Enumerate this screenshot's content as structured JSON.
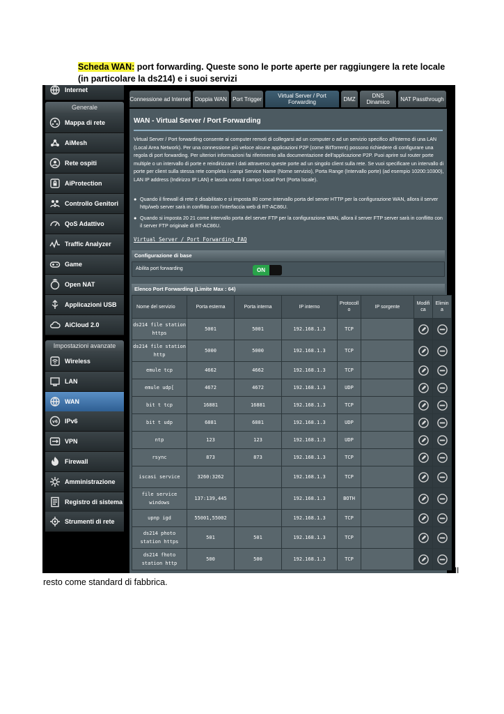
{
  "doc": {
    "header_highlight": "Scheda WAN:",
    "header_text": " port forwarding. Queste sono le porte aperte per raggiungere la rete locale (in particolare la ds214) e i suoi servizi",
    "footer_right": "Il",
    "footer_text": "resto come standard di fabbrica."
  },
  "sidebar": {
    "top_item": "Internet",
    "general_header": "Generale",
    "general_items": [
      "Mappa di rete",
      "AiMesh",
      "Rete ospiti",
      "AiProtection",
      "Controllo Genitori",
      "QoS Adattivo",
      "Traffic Analyzer",
      "Game",
      "Open NAT",
      "Applicazioni USB",
      "AiCloud 2.0"
    ],
    "advanced_header": "Impostazioni avanzate",
    "advanced_items": [
      "Wireless",
      "LAN",
      "WAN",
      "IPv6",
      "VPN",
      "Firewall",
      "Amministrazione",
      "Registro di sistema",
      "Strumenti di rete"
    ],
    "active_item": "WAN",
    "icons": {
      "internet": "globe-icon",
      "network-map": "network-icon",
      "aimesh": "mesh-icon",
      "guest": "guest-network-icon",
      "aiprotection": "shield-lock-icon",
      "parental": "family-icon",
      "qos": "gauge-icon",
      "traffic": "chart-icon",
      "game": "gamepad-icon",
      "opennat": "nat-icon",
      "usb": "usb-icon",
      "aicloud": "cloud-icon",
      "wireless": "wifi-icon",
      "lan": "lan-icon",
      "wan": "wan-globe-icon",
      "ipv6": "ipv6-icon",
      "vpn": "vpn-icon",
      "firewall": "fire-icon",
      "admin": "admin-icon",
      "syslog": "log-icon",
      "tools": "tools-icon"
    }
  },
  "tabs": [
    "Connessione ad Internet",
    "Doppia WAN",
    "Port Trigger",
    "Virtual Server / Port Forwarding",
    "DMZ",
    "DNS Dinamico",
    "NAT Passthrough"
  ],
  "active_tab": "Virtual Server / Port Forwarding",
  "main": {
    "title": "WAN - Virtual Server / Port Forwarding",
    "description": "Virtual Server / Port forwarding consente ai computer remoti di collegarsi ad un computer o ad un servizio specifico all'interno di una LAN (Local Area Network). Per una connessione più veloce alcune applicazioni P2P (come BitTorrent) possono richiedere di configurare una regola di port forwarding. Per ulteriori informazioni fai riferimento alla documentazione dell'applicazione P2P. Puoi aprire sul router porte multiple o un intervallo di porte e reindirizzare i dati attraverso queste porte ad un singolo client sulla rete. Se vuoi specificare un intervallo di porte per client sulla stessa rete completa i campi Service Name (Nome servizio), Porta Range (Intervallo porte) (ad esempio 10200:10300), LAN IP address (Indirizzo IP LAN) e lascia vuoto il campo Local Port (Porta locale).",
    "bullet1": "Quando il firewall di rete è disabilitato e si imposta 80 come intervallo porta del server HTTP per la configurazione WAN, allora il server http/web server sarà in conflitto con l'interfaccia web di RT-AC86U.",
    "bullet2": "Quando si imposta 20 21 come intervallo porta del server FTP per la configurazione WAN, allora il server FTP server sarà in conflitto con il server FTP originale di RT-AC86U.",
    "faq_link": "Virtual Server / Port Forwarding FAQ",
    "basic_config_header": "Configurazione di base",
    "enable_label": "Abilita port forwarding",
    "toggle_label": "ON",
    "toggle_on_color": "#29a34a",
    "list_header": "Elenco Port Forwarding (Limite Max : 64)"
  },
  "table": {
    "columns": [
      "Nome del servizio",
      "Porta esterna",
      "Porta interna",
      "IP interno",
      "Protocoll o",
      "IP sorgente",
      "Modifi ca",
      "Elimin a"
    ],
    "rows": [
      {
        "name": "ds214 file station https",
        "ext": "5001",
        "int": "5001",
        "ip": "192.168.1.3",
        "proto": "TCP",
        "src": ""
      },
      {
        "name": "ds214 file station http",
        "ext": "5000",
        "int": "5000",
        "ip": "192.168.1.3",
        "proto": "TCP",
        "src": ""
      },
      {
        "name": "emule tcp",
        "ext": "4662",
        "int": "4662",
        "ip": "192.168.1.3",
        "proto": "TCP",
        "src": ""
      },
      {
        "name": "emule udp[",
        "ext": "4672",
        "int": "4672",
        "ip": "192.168.1.3",
        "proto": "UDP",
        "src": ""
      },
      {
        "name": "bit t tcp",
        "ext": "16881",
        "int": "16881",
        "ip": "192.168.1.3",
        "proto": "TCP",
        "src": ""
      },
      {
        "name": "bit t udp",
        "ext": "6881",
        "int": "6881",
        "ip": "192.168.1.3",
        "proto": "UDP",
        "src": ""
      },
      {
        "name": "ntp",
        "ext": "123",
        "int": "123",
        "ip": "192.168.1.3",
        "proto": "UDP",
        "src": ""
      },
      {
        "name": "rsync",
        "ext": "873",
        "int": "873",
        "ip": "192.168.1.3",
        "proto": "TCP",
        "src": ""
      },
      {
        "name": "iscasi service",
        "ext": "3260:3262",
        "int": "",
        "ip": "192.168.1.3",
        "proto": "TCP",
        "src": ""
      },
      {
        "name": "file service windows",
        "ext": "137:139,445",
        "int": "",
        "ip": "192.168.1.3",
        "proto": "BOTH",
        "src": ""
      },
      {
        "name": "upnp igd",
        "ext": "55001,55002",
        "int": "",
        "ip": "192.168.1.3",
        "proto": "TCP",
        "src": ""
      },
      {
        "name": "ds214 photo station https",
        "ext": "501",
        "int": "501",
        "ip": "192.168.1.3",
        "proto": "TCP",
        "src": ""
      },
      {
        "name": "ds214 fhoto station http",
        "ext": "500",
        "int": "500",
        "ip": "192.168.1.3",
        "proto": "TCP",
        "src": ""
      }
    ],
    "edit_icon": "edit-icon",
    "delete_icon": "delete-icon"
  }
}
